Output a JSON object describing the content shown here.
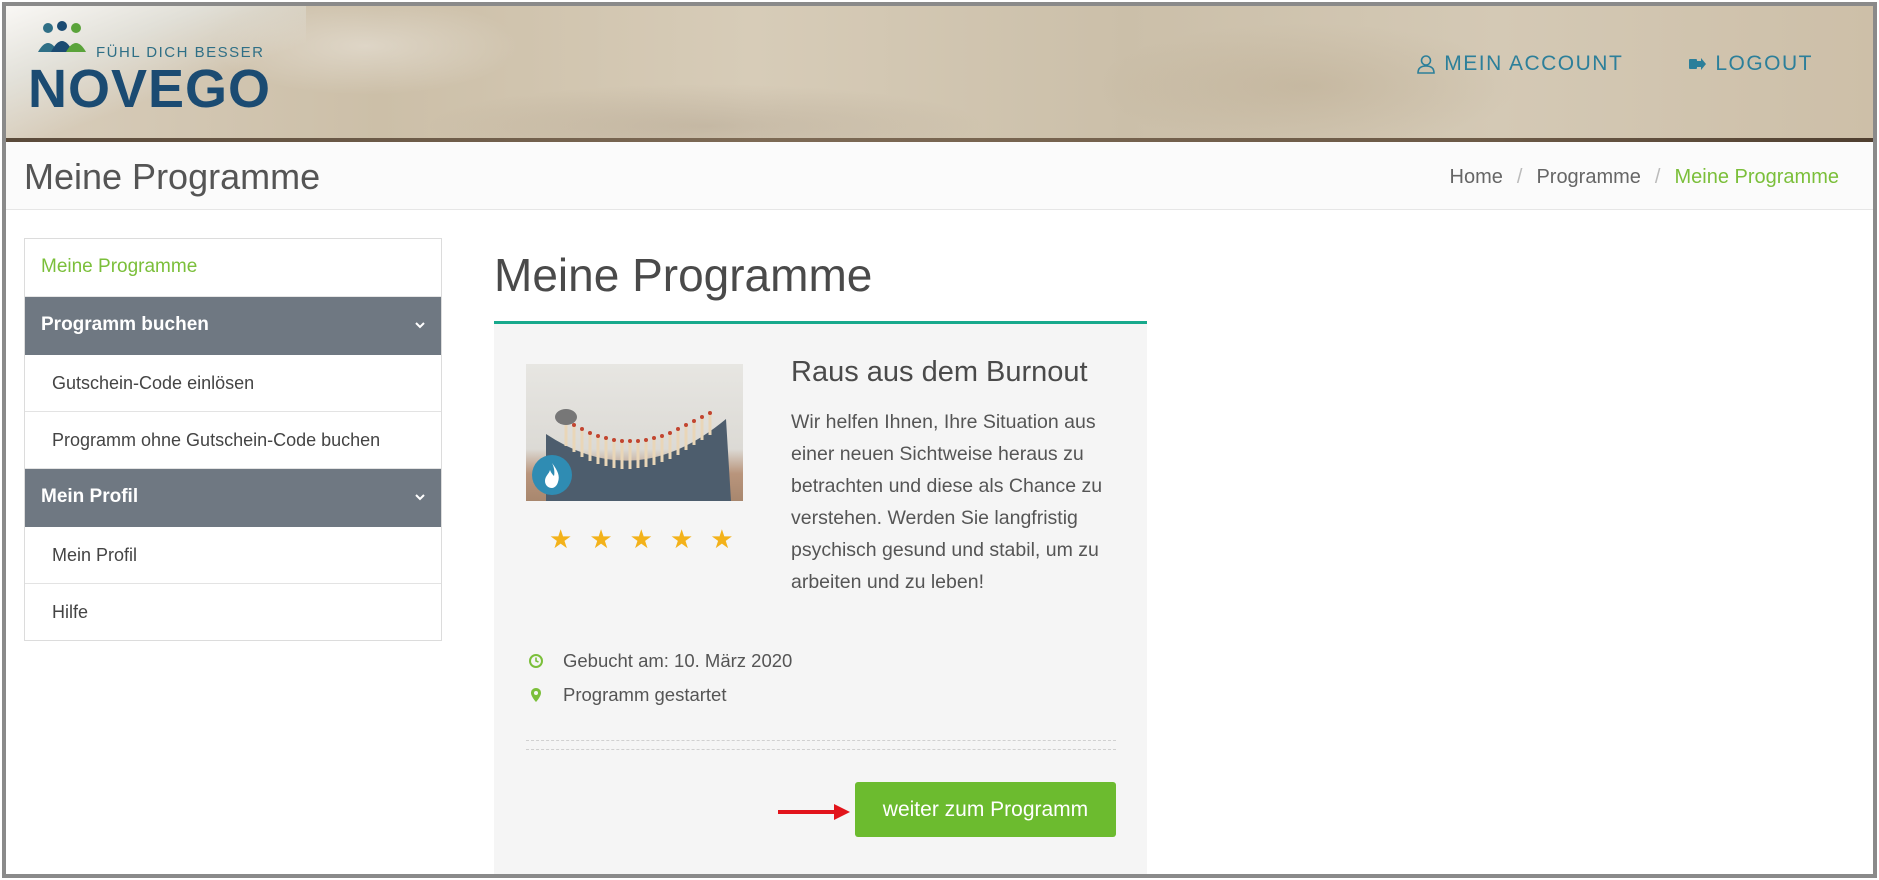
{
  "header": {
    "brand": "NOVEGO",
    "tagline": "FÜHL DICH BESSER",
    "nav": [
      {
        "label": "MEIN ACCOUNT",
        "icon": "user-icon"
      },
      {
        "label": "LOGOUT",
        "icon": "logout-icon"
      }
    ]
  },
  "titlebar": {
    "title": "Meine Programme",
    "breadcrumb": [
      "Home",
      "Programme",
      "Meine Programme"
    ]
  },
  "sidebar": {
    "top": "Meine Programme",
    "groups": [
      {
        "label": "Programm buchen",
        "items": [
          "Gutschein-Code einlösen",
          "Programm ohne Gutschein-Code buchen"
        ]
      },
      {
        "label": "Mein Profil",
        "items": [
          "Mein Profil",
          "Hilfe"
        ]
      }
    ]
  },
  "main": {
    "title": "Meine Programme",
    "card": {
      "title": "Raus aus dem Burnout",
      "description": "Wir helfen Ihnen, Ihre Situation aus einer neuen Sichtweise heraus zu betrachten und diese als Chance zu verstehen. Werden Sie langfristig psychisch gesund und stabil, um zu arbeiten und zu leben!",
      "rating": 5,
      "booked": "Gebucht am: 10. März 2020",
      "status": "Programm gestartet",
      "button": "weiter zum Programm"
    }
  },
  "colors": {
    "accent_green": "#6cbb2f",
    "link_blue": "#2c7f9a",
    "sidebar_group": "#6f7882",
    "rule_teal": "#17a98c",
    "star": "#f3b21a",
    "annotation_arrow": "#e2141b"
  }
}
